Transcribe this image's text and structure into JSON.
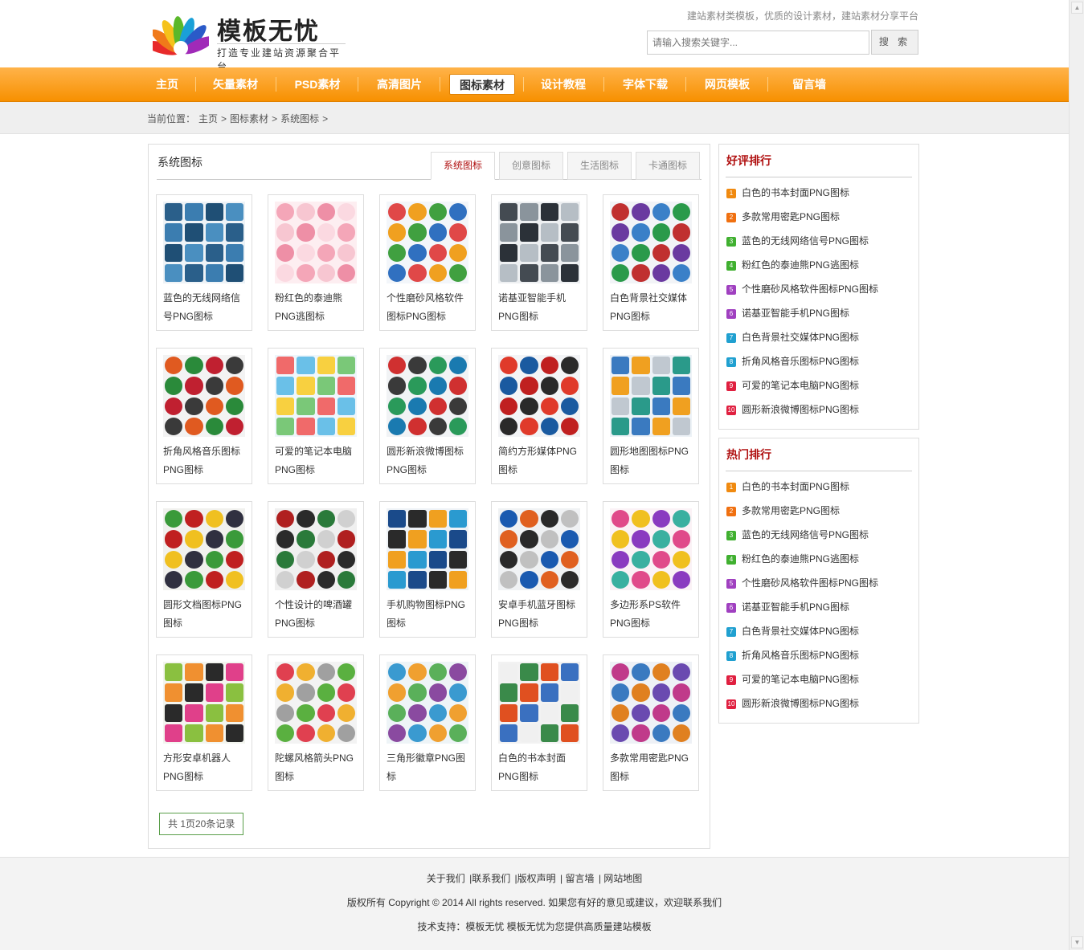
{
  "site": {
    "logo_name": "模板无忧",
    "logo_sub": "打造专业建站资源聚合平台",
    "slogan": "建站素材类模板，优质的设计素材，建站素材分享平台",
    "search_placeholder": "请输入搜索关键字...",
    "search_button": "搜 索"
  },
  "nav": [
    {
      "label": "主页",
      "active": false
    },
    {
      "label": "矢量素材",
      "active": false
    },
    {
      "label": "PSD素材",
      "active": false
    },
    {
      "label": "高清图片",
      "active": false
    },
    {
      "label": "图标素材",
      "active": true
    },
    {
      "label": "设计教程",
      "active": false
    },
    {
      "label": "字体下载",
      "active": false
    },
    {
      "label": "网页模板",
      "active": false
    },
    {
      "label": "留言墙",
      "active": false
    }
  ],
  "breadcrumb": {
    "prefix": "当前位置：",
    "items": [
      "主页",
      "图标素材",
      "系统图标"
    ],
    "sep": ">"
  },
  "main": {
    "title": "系统图标",
    "tabs": [
      {
        "label": "系统图标",
        "active": true
      },
      {
        "label": "创意图标",
        "active": false
      },
      {
        "label": "生活图标",
        "active": false
      },
      {
        "label": "卡通图标",
        "active": false
      }
    ],
    "items": [
      {
        "title": "蓝色的无线网络信号PNG图标",
        "colors": [
          "#2a5f8a",
          "#3b7db0",
          "#1f4f75",
          "#4a8fc0"
        ],
        "bg": "#eef3f7"
      },
      {
        "title": "粉红色的泰迪熊PNG逃图标",
        "colors": [
          "#f4a6b8",
          "#f7c6d1",
          "#ee8fa6",
          "#fbd9e1"
        ],
        "bg": "#fdeef1"
      },
      {
        "title": "个性磨砂风格软件图标PNG图标",
        "colors": [
          "#e04848",
          "#f0a020",
          "#40a040",
          "#3070c0"
        ],
        "bg": "#f3f6fa"
      },
      {
        "title": "诺基亚智能手机PNG图标",
        "colors": [
          "#444b52",
          "#8a949c",
          "#2b3138",
          "#b6bec5"
        ],
        "bg": "#eef0f2"
      },
      {
        "title": "白色背景社交媒体PNG图标",
        "colors": [
          "#c03030",
          "#6a3aa0",
          "#3a80c8",
          "#2a9a4a"
        ],
        "bg": "#f2f4f7"
      },
      {
        "title": "折角风格音乐图标PNG图标",
        "colors": [
          "#e05a20",
          "#2a8a3a",
          "#c02030",
          "#3a3a3a"
        ],
        "bg": "#f3f3f3"
      },
      {
        "title": "可爱的笔记本电脑PNG图标",
        "colors": [
          "#f06a6a",
          "#6ac0e8",
          "#f8d040",
          "#7ac878"
        ],
        "bg": "#eef6fb"
      },
      {
        "title": "圆形新浪微博图标PNG图标",
        "colors": [
          "#d03030",
          "#3a3a3a",
          "#2a9a5a",
          "#1a7ab0"
        ],
        "bg": "#f1f3f5"
      },
      {
        "title": "简约方形媒体PNG图标",
        "colors": [
          "#e03a2a",
          "#1a5aa0",
          "#c02020",
          "#2a2a2a"
        ],
        "bg": "#f3f4f6"
      },
      {
        "title": "圆形地图图标PNG图标",
        "colors": [
          "#3a7ac0",
          "#f0a020",
          "#c0c8d0",
          "#2a9a8a"
        ],
        "bg": "#edf2f7"
      },
      {
        "title": "圆形文档图标PNG图标",
        "colors": [
          "#3a9a3a",
          "#c02020",
          "#f0c020",
          "#303040"
        ],
        "bg": "#f1f1ee"
      },
      {
        "title": "个性设计的啤酒罐PNG图标",
        "colors": [
          "#b02020",
          "#2a2a2a",
          "#2a7a3a",
          "#d0d0d0"
        ],
        "bg": "#f0f0f0"
      },
      {
        "title": "手机购物图标PNG图标",
        "colors": [
          "#1a4a8a",
          "#2a2a2a",
          "#f0a020",
          "#2a9ad0"
        ],
        "bg": "#eef2f6"
      },
      {
        "title": "安卓手机蓝牙图标PNG图标",
        "colors": [
          "#1a5ab0",
          "#e06020",
          "#2a2a2a",
          "#c0c0c0"
        ],
        "bg": "#f0f2f4"
      },
      {
        "title": "多边形系PS软件PNG图标",
        "colors": [
          "#e04a8a",
          "#f0c020",
          "#8a3ac0",
          "#3ab0a0"
        ],
        "bg": "#fbf2f6"
      },
      {
        "title": "方形安卓机器人PNG图标",
        "colors": [
          "#8ac040",
          "#f09030",
          "#2a2a2a",
          "#e0408a"
        ],
        "bg": "#f3f5ef"
      },
      {
        "title": "陀螺风格箭头PNG图标",
        "colors": [
          "#e04050",
          "#f0b030",
          "#a0a0a0",
          "#5ab040"
        ],
        "bg": "#f3f3f3"
      },
      {
        "title": "三角形徽章PNG图标",
        "colors": [
          "#3a9ad0",
          "#f0a030",
          "#5ab05a",
          "#8a4aa0"
        ],
        "bg": "#eef4f7"
      },
      {
        "title": "白色的书本封面PNG图标",
        "colors": [
          "#f0f0f0",
          "#3a8a4a",
          "#e05020",
          "#3a70c0"
        ],
        "bg": "#f2f2f2"
      },
      {
        "title": "多款常用密匙PNG图标",
        "colors": [
          "#c03a8a",
          "#3a7ac0",
          "#e08020",
          "#6a4ab0"
        ],
        "bg": "#eef1f6"
      }
    ],
    "pager": "共 1页20条记录"
  },
  "sidebar": {
    "good": {
      "title": "好评排行",
      "items": [
        {
          "num": "1",
          "label": "白色的书本封面PNG图标",
          "color": "#f08a10"
        },
        {
          "num": "2",
          "label": "多款常用密匙PNG图标",
          "color": "#f07010"
        },
        {
          "num": "3",
          "label": "蓝色的无线网络信号PNG图标",
          "color": "#40b030"
        },
        {
          "num": "4",
          "label": "粉红色的泰迪熊PNG逃图标",
          "color": "#40b030"
        },
        {
          "num": "5",
          "label": "个性磨砂风格软件图标PNG图标",
          "color": "#a040c0"
        },
        {
          "num": "6",
          "label": "诺基亚智能手机PNG图标",
          "color": "#a040c0"
        },
        {
          "num": "7",
          "label": "白色背景社交媒体PNG图标",
          "color": "#20a0d0"
        },
        {
          "num": "8",
          "label": "折角风格音乐图标PNG图标",
          "color": "#20a0d0"
        },
        {
          "num": "9",
          "label": "可爱的笔记本电脑PNG图标",
          "color": "#e02040"
        },
        {
          "num": "10",
          "label": "圆形新浪微博图标PNG图标",
          "color": "#e02040"
        }
      ]
    },
    "hot": {
      "title": "热门排行",
      "items": [
        {
          "num": "1",
          "label": "白色的书本封面PNG图标",
          "color": "#f08a10"
        },
        {
          "num": "2",
          "label": "多款常用密匙PNG图标",
          "color": "#f07010"
        },
        {
          "num": "3",
          "label": "蓝色的无线网络信号PNG图标",
          "color": "#40b030"
        },
        {
          "num": "4",
          "label": "粉红色的泰迪熊PNG逃图标",
          "color": "#40b030"
        },
        {
          "num": "5",
          "label": "个性磨砂风格软件图标PNG图标",
          "color": "#a040c0"
        },
        {
          "num": "6",
          "label": "诺基亚智能手机PNG图标",
          "color": "#a040c0"
        },
        {
          "num": "7",
          "label": "白色背景社交媒体PNG图标",
          "color": "#20a0d0"
        },
        {
          "num": "8",
          "label": "折角风格音乐图标PNG图标",
          "color": "#20a0d0"
        },
        {
          "num": "9",
          "label": "可爱的笔记本电脑PNG图标",
          "color": "#e02040"
        },
        {
          "num": "10",
          "label": "圆形新浪微博图标PNG图标",
          "color": "#e02040"
        }
      ]
    }
  },
  "footer": {
    "links": [
      "关于我们",
      "|联系我们",
      "|版权声明",
      "| 留言墙",
      "| 网站地图"
    ],
    "copyright": "版权所有 Copyright © 2014 All rights reserved. 如果您有好的意见或建议，欢迎联系我们",
    "support": "技术支持：模板无忧 模板无忧为您提供高质量建站模板"
  }
}
